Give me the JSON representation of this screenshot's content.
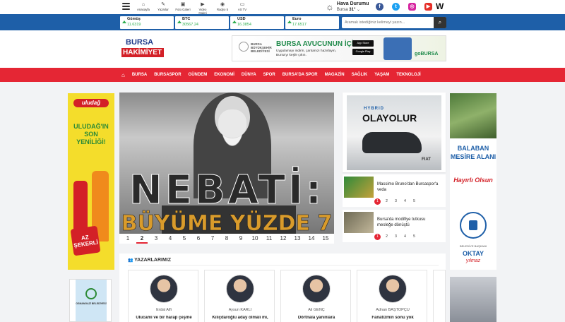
{
  "topbar": {
    "nav": [
      {
        "icon": "home-icon",
        "label": "Anasayfa",
        "glyph": "⌂"
      },
      {
        "icon": "writer-icon",
        "label": "Yazarlar",
        "glyph": "✎"
      },
      {
        "icon": "photo-icon",
        "label": "Foto Galeri",
        "glyph": "▣"
      },
      {
        "icon": "video-icon",
        "label": "Video Galeri",
        "glyph": "▶"
      },
      {
        "icon": "radio-icon",
        "label": "Radyo 5",
        "glyph": "◉"
      },
      {
        "icon": "tv-icon",
        "label": "AS TV",
        "glyph": "▭"
      }
    ],
    "weather": {
      "title": "Hava Durumu",
      "city": "Bursa",
      "temp": "31°"
    },
    "socials": [
      {
        "icon": "facebook-icon",
        "glyph": "f",
        "color": "#3b5998"
      },
      {
        "icon": "twitter-icon",
        "glyph": "t",
        "color": "#1da1f2"
      },
      {
        "icon": "instagram-icon",
        "glyph": "◎",
        "color": "#d6249f"
      },
      {
        "icon": "youtube-icon",
        "glyph": "▶",
        "color": "#e52d27"
      }
    ],
    "w_logo": "W"
  },
  "ticker": {
    "items": [
      {
        "name": "Gümüş",
        "value": "11.6319"
      },
      {
        "name": "BTC",
        "value": "30567.24"
      },
      {
        "name": "USD",
        "value": "16.3854"
      },
      {
        "name": "Euro",
        "value": "17.6517"
      }
    ],
    "search_placeholder": "Aramak istediğiniz kelimeyi yazın..."
  },
  "logo": {
    "line1": "BURSA",
    "line2": "HAKİMİYET"
  },
  "banner": {
    "org": "BURSA BÜYÜKŞEHİR BELEDİYESİ",
    "title": "BURSA AVUCUNUN İÇİNDE!",
    "subtitle": "Uygulamayı indirin, çantanızı hazırlayın, Bursa'yı keşfe çıkın.",
    "store1": "App Store",
    "store2": "Google Play",
    "brand": "goBURSA"
  },
  "menu": [
    "BURSA",
    "BURSASPOR",
    "GÜNDEM",
    "EKONOMİ",
    "DÜNYA",
    "SPOR",
    "BURSA'DA SPOR",
    "MAGAZİN",
    "SAĞLIK",
    "YAŞAM",
    "TEKNOLOJİ"
  ],
  "left_ad": {
    "brand": "uludağ",
    "slogan": "ULUDAĞ'IN SON YENİLİĞİ!",
    "sugar": "AZ ŞEKERLİ"
  },
  "right_ad": {
    "title": "BALABAN MESİRE ALANI",
    "wish": "Hayırlı Olsun",
    "mayor_label": "BELEDİYE BAŞKANI",
    "mayor": "OKTAY",
    "mayor2": "yılmaz"
  },
  "left_ad2": {
    "label": "OSMANGAZİ BELEDİYESİ"
  },
  "hero": {
    "headline1": "NEBATİ:",
    "headline2": "BÜYÜME YÜZDE 7",
    "pages": [
      "1",
      "2",
      "3",
      "4",
      "5",
      "6",
      "7",
      "8",
      "9",
      "10",
      "11",
      "12",
      "13",
      "14",
      "15"
    ],
    "active_page": "2"
  },
  "right_card": {
    "line1": "HYBRID",
    "line2": "OLAYOLUR",
    "brand": "FIAT"
  },
  "side_news": [
    {
      "title": "Massimo Bruno'dan Bursaspor'a veda",
      "pages": [
        "1",
        "2",
        "3",
        "4",
        "5"
      ]
    },
    {
      "title": "Bursa'da modifiye tutkusu mesleğe dönüştü",
      "pages": [
        "1",
        "2",
        "3",
        "4",
        "5"
      ]
    }
  ],
  "authors": {
    "header": "YAZARLARIMIZ",
    "items": [
      {
        "name": "Erdal Alfi",
        "title": "Ulucami ve bir harap çeşme"
      },
      {
        "name": "Aysun KARLI",
        "title": "Kılıçdaroğlu aday olmalı mı,"
      },
      {
        "name": "Ali GENÇ",
        "title": "Dörtnala yanınlara"
      },
      {
        "name": "Adnan BAŞTOPÇU",
        "title": "Fanatizmin sonu yok"
      }
    ]
  }
}
